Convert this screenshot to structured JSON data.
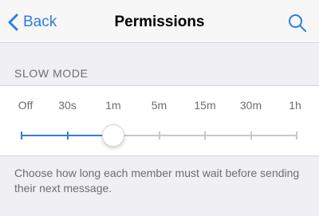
{
  "navbar": {
    "back_label": "Back",
    "title": "Permissions",
    "back_icon": "chevron-left-icon",
    "search_icon": "search-icon",
    "accent_color": "#2f7de1"
  },
  "slow_mode": {
    "section_header": "SLOW MODE",
    "options": [
      "Off",
      "30s",
      "1m",
      "5m",
      "15m",
      "30m",
      "1h"
    ],
    "selected_index": 2,
    "selected_value": "1m",
    "footer": "Choose how long each member must wait before sending their next message."
  }
}
